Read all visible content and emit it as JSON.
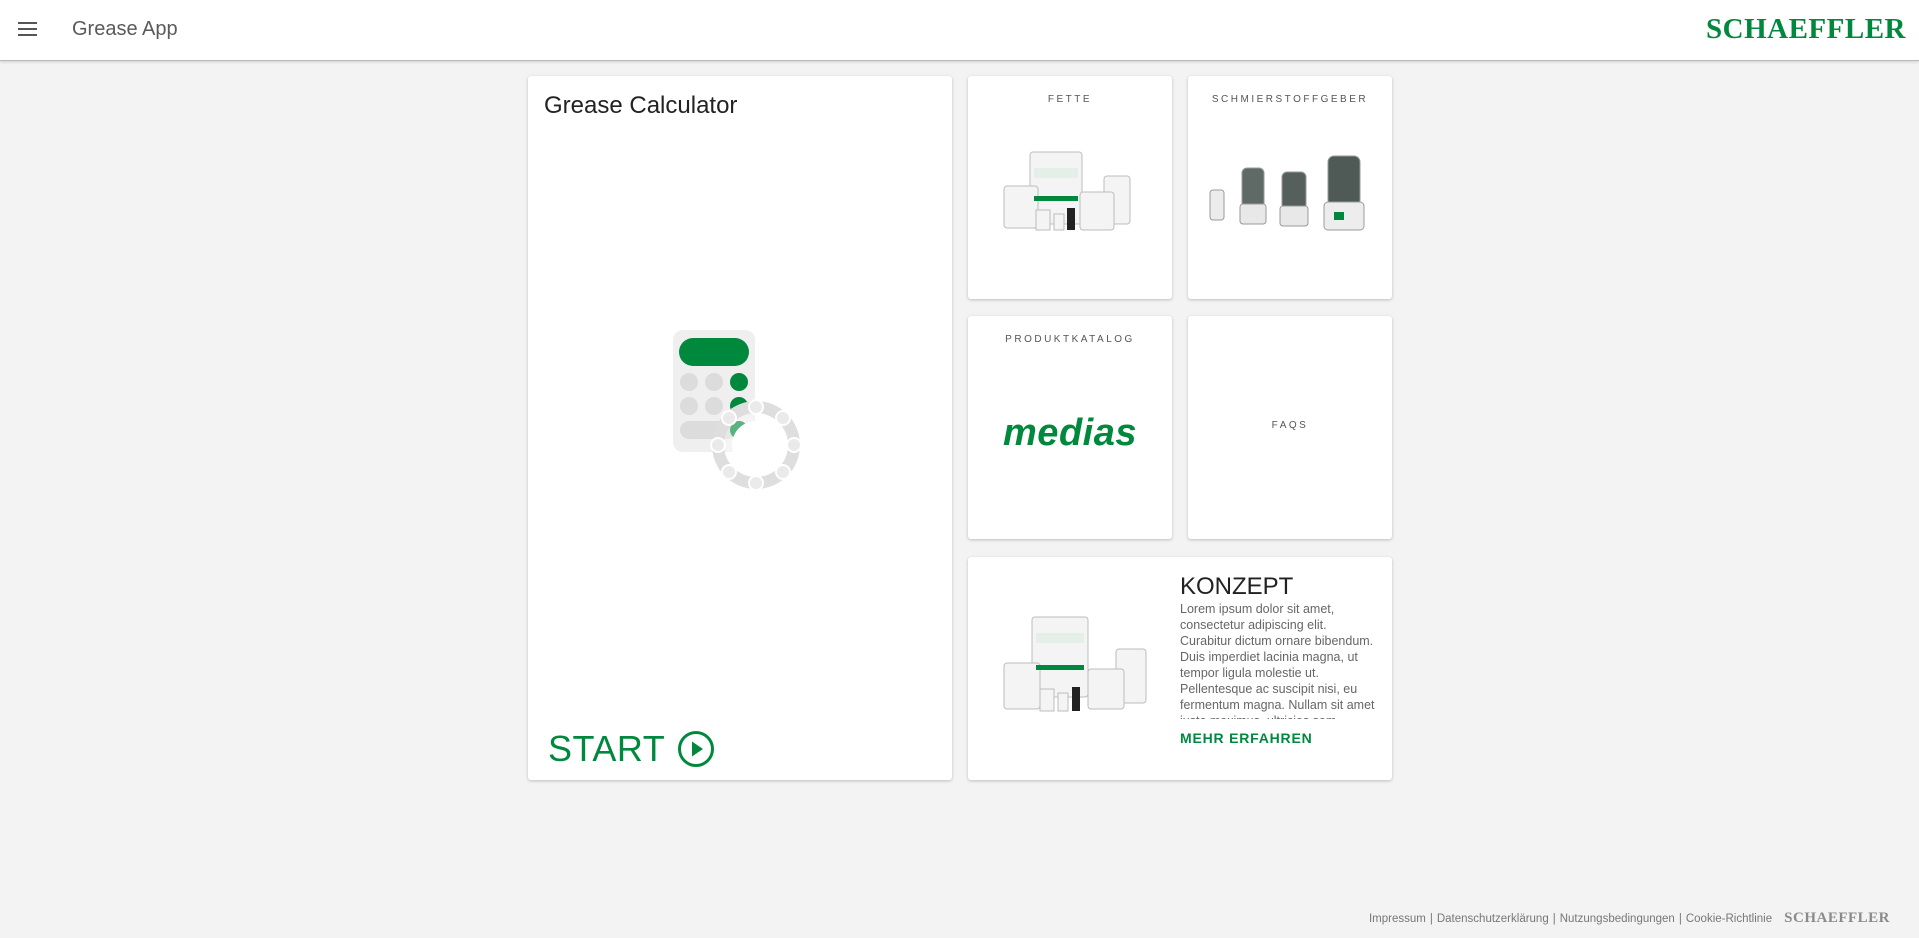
{
  "header": {
    "menu_icon": "hamburger-menu-icon",
    "app_title": "Grease App",
    "brand": "SCHAEFFLER"
  },
  "calculator_card": {
    "title": "Grease Calculator",
    "icon": "calculator-bearing-icon",
    "start_label": "START",
    "start_icon": "play-circle-icon"
  },
  "tiles": {
    "fette": {
      "label": "FETTE",
      "image": "grease-buckets-image"
    },
    "schmierstoffgeber": {
      "label": "SCHMIERSTOFFGEBER",
      "image": "lubricators-image"
    },
    "produktkatalog": {
      "label": "PRODUKTKATALOG",
      "logo_text": "medias"
    },
    "faqs": {
      "label": "FAQS"
    }
  },
  "konzept": {
    "title": "KONZEPT",
    "text": "Lorem ipsum dolor sit amet, consectetur adipiscing elit. Curabitur dictum ornare bibendum. Duis imperdiet lacinia magna, ut tempor ligula molestie ut. Pellentesque ac suscipit nisi, eu fermentum magna. Nullam sit amet justo maximus, ultricies sem",
    "link": "MEHR ERFAHREN",
    "image": "grease-buckets-image"
  },
  "footer": {
    "links": [
      "Impressum",
      "Datenschutzerklärung",
      "Nutzungsbedingungen",
      "Cookie-Richtlinie"
    ],
    "separator": "|",
    "brand": "SCHAEFFLER"
  },
  "colors": {
    "brand_green": "#00893d",
    "background": "#f3f3f3",
    "card": "#ffffff"
  }
}
